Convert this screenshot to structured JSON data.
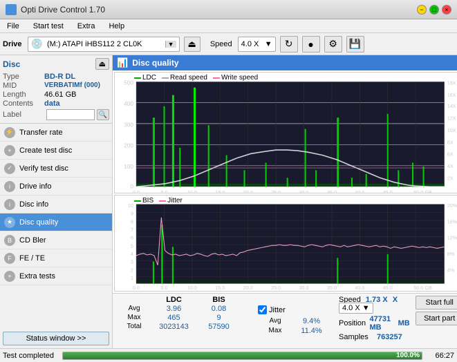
{
  "app": {
    "title": "Opti Drive Control 1.70",
    "icon": "⬡"
  },
  "titlebar": {
    "minimize": "−",
    "maximize": "□",
    "close": "×"
  },
  "menu": {
    "items": [
      "File",
      "Start test",
      "Extra",
      "Help"
    ]
  },
  "toolbar": {
    "drive_label": "Drive",
    "drive_icon": "💿",
    "drive_text": "(M:) ATAPI iHBS112  2 CL0K",
    "dropdown_arrow": "▼",
    "eject_icon": "⏏",
    "speed_label": "Speed",
    "speed_value": "4.0 X",
    "speed_arrow": "▼",
    "icon_refresh": "↻",
    "icon_burn": "●",
    "icon_tools": "🔧",
    "icon_save": "💾"
  },
  "disc": {
    "title": "Disc",
    "eject_label": "⏏",
    "type_key": "Type",
    "type_val": "BD-R DL",
    "mid_key": "MID",
    "mid_val": "VERBATIMf (000)",
    "length_key": "Length",
    "length_val": "46.61 GB",
    "contents_key": "Contents",
    "contents_val": "data",
    "label_key": "Label",
    "label_placeholder": "",
    "search_icon": "🔍"
  },
  "nav": {
    "items": [
      {
        "id": "transfer-rate",
        "label": "Transfer rate",
        "active": false
      },
      {
        "id": "create-test-disc",
        "label": "Create test disc",
        "active": false
      },
      {
        "id": "verify-test-disc",
        "label": "Verify test disc",
        "active": false
      },
      {
        "id": "drive-info",
        "label": "Drive info",
        "active": false
      },
      {
        "id": "disc-info",
        "label": "Disc info",
        "active": false
      },
      {
        "id": "disc-quality",
        "label": "Disc quality",
        "active": true
      },
      {
        "id": "cd-bler",
        "label": "CD Bler",
        "active": false
      },
      {
        "id": "fe-te",
        "label": "FE / TE",
        "active": false
      },
      {
        "id": "extra-tests",
        "label": "Extra tests",
        "active": false
      }
    ]
  },
  "status_window_btn": "Status window >>",
  "chart": {
    "title": "Disc quality",
    "icon": "📊",
    "top": {
      "legend": [
        {
          "label": "LDC",
          "color": "#00aa00"
        },
        {
          "label": "Read speed",
          "color": "#ffffff"
        },
        {
          "label": "Write speed",
          "color": "#ff69b4"
        }
      ],
      "y_max": 500,
      "y_labels": [
        "500",
        "400",
        "300",
        "200",
        "100",
        "0"
      ],
      "y2_labels": [
        "18X",
        "16X",
        "14X",
        "12X",
        "10X",
        "8X",
        "6X",
        "4X",
        "2X"
      ],
      "x_labels": [
        "0.0",
        "5.0",
        "10.0",
        "15.0",
        "20.0",
        "25.0",
        "30.0",
        "35.0",
        "40.0",
        "45.0",
        "50.0 GB"
      ]
    },
    "bottom": {
      "legend": [
        {
          "label": "BIS",
          "color": "#00aa00"
        },
        {
          "label": "Jitter",
          "color": "#ff69b4"
        }
      ],
      "y_max": 10,
      "y_labels": [
        "10",
        "9",
        "8",
        "7",
        "6",
        "5",
        "4",
        "3",
        "2",
        "1"
      ],
      "y2_labels": [
        "20%",
        "16%",
        "12%",
        "8%",
        "4%"
      ],
      "x_labels": [
        "0.0",
        "5.0",
        "10.0",
        "15.0",
        "20.0",
        "25.0",
        "30.0",
        "35.0",
        "40.0",
        "45.0",
        "50.0 GB"
      ]
    }
  },
  "stats": {
    "headers": [
      "",
      "LDC",
      "BIS",
      "",
      "Jitter",
      "Speed"
    ],
    "rows": [
      {
        "label": "Avg",
        "ldc": "3.96",
        "bis": "0.08",
        "jitter": "9.4%",
        "speed": "1.73 X"
      },
      {
        "label": "Max",
        "ldc": "465",
        "bis": "9",
        "jitter": "11.4%",
        "speed_label": "Position",
        "speed": "47731 MB"
      },
      {
        "label": "Total",
        "ldc": "3023143",
        "bis": "57590",
        "jitter": "",
        "speed_label": "Samples",
        "speed": "763257"
      }
    ],
    "jitter_checked": true,
    "jitter_label": "Jitter",
    "speed_label": "Speed",
    "speed_value": "4.0 X",
    "speed_arrow": "▼"
  },
  "buttons": {
    "start_full": "Start full",
    "start_part": "Start part"
  },
  "progress": {
    "status": "Test completed",
    "percent": 100.0,
    "percent_text": "100.0%",
    "time": "66:27"
  }
}
